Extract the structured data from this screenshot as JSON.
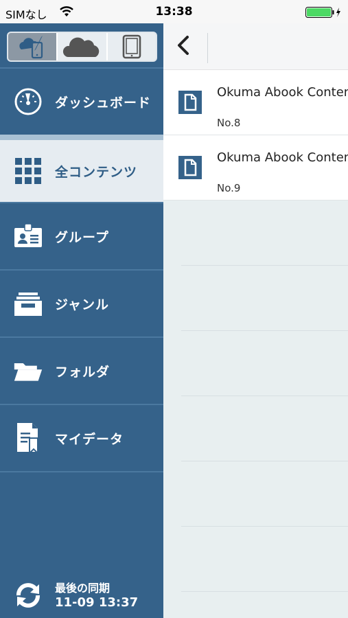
{
  "status_bar": {
    "carrier": "SIMなし",
    "time": "13:38"
  },
  "sidebar": {
    "segments": [
      {
        "icon": "device-cloud-sync-icon",
        "active": true
      },
      {
        "icon": "cloud-icon",
        "active": false
      },
      {
        "icon": "tablet-icon",
        "active": false
      }
    ],
    "menu": [
      {
        "label": "ダッシュボード",
        "icon": "dashboard-gauge-icon"
      },
      {
        "label": "全コンテンツ",
        "icon": "grid-icon",
        "active": true
      },
      {
        "label": "グループ",
        "icon": "id-badge-icon"
      },
      {
        "label": "ジャンル",
        "icon": "tray-icon"
      },
      {
        "label": "フォルダ",
        "icon": "folder-icon"
      },
      {
        "label": "マイデータ",
        "icon": "bookmark-document-icon"
      }
    ],
    "sync": {
      "label": "最後の同期",
      "date": "11-09 13:37"
    }
  },
  "content": {
    "items": [
      {
        "title": "Okuma Abook Contents",
        "sub": "No.8"
      },
      {
        "title": "Okuma Abook Contents",
        "sub": "No.9"
      }
    ]
  },
  "colors": {
    "sidebar": "#35628a",
    "active_item_bg": "#e6ecf1",
    "content_bg": "#e8eff0",
    "battery": "#4cd964"
  }
}
